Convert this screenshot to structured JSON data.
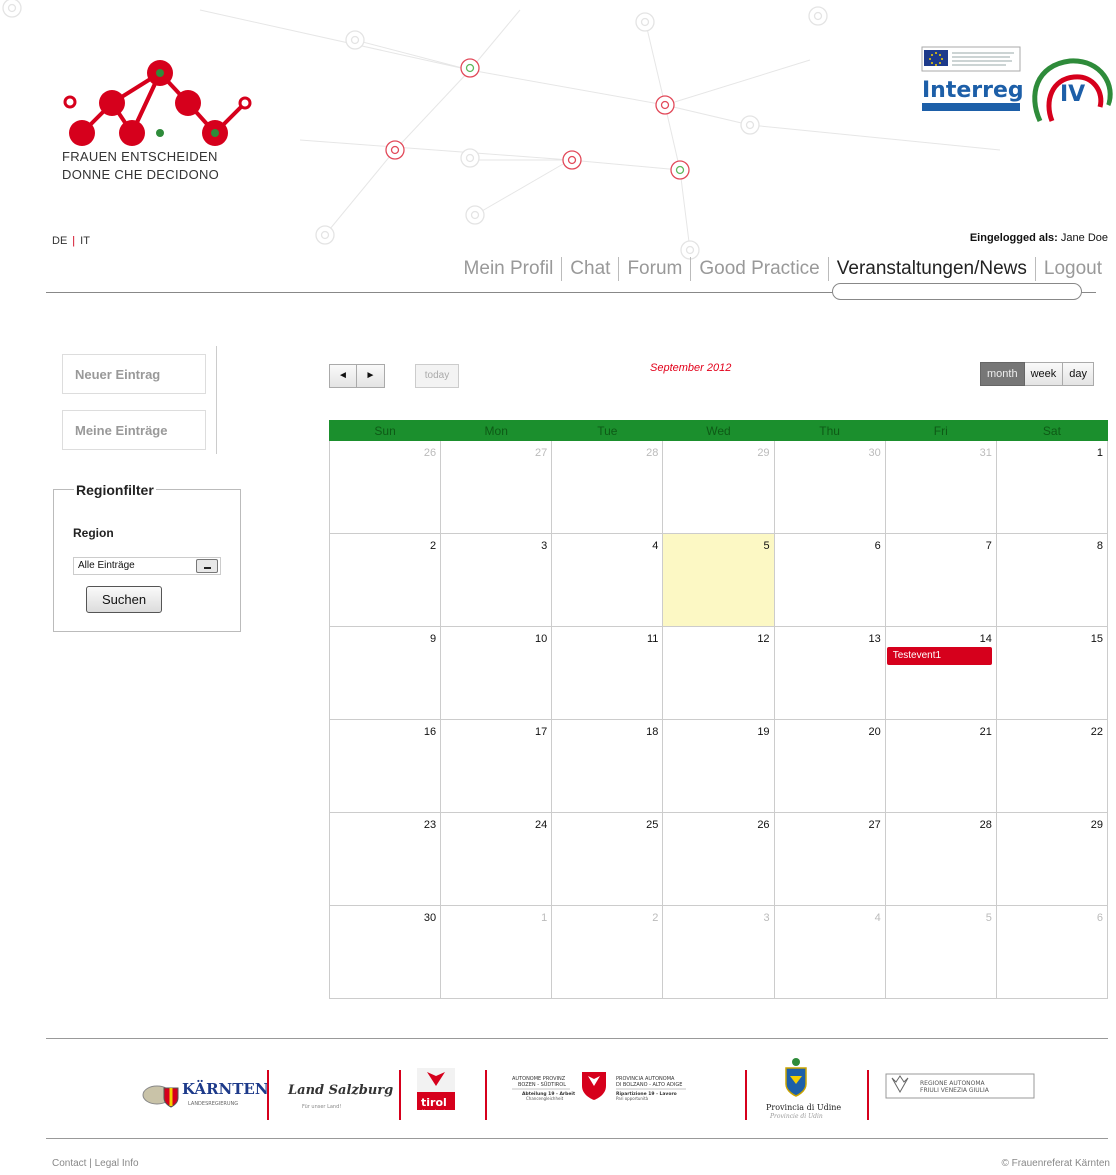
{
  "brand": {
    "line1": "FRAUEN ENTSCHEIDEN",
    "line2": "DONNE CHE DECIDONO"
  },
  "interreg": {
    "text": "Interreg",
    "roman": "IV"
  },
  "languages": [
    "DE",
    "IT"
  ],
  "user": {
    "label": "Eingelogged als:",
    "name": "Jane Doe"
  },
  "nav": [
    "Mein Profil",
    "Chat",
    "Forum",
    "Good Practice",
    "Veranstaltungen/News",
    "Logout"
  ],
  "sidebar": {
    "buttons": [
      "Neuer Eintrag",
      "Meine Einträge"
    ],
    "filter": {
      "legend": "Regionfilter",
      "label": "Region",
      "select": "Alle Einträge",
      "submit": "Suchen"
    }
  },
  "calendar": {
    "prev": "◄",
    "next": "►",
    "today": "today",
    "title": "September 2012",
    "views": [
      "month",
      "week",
      "day"
    ],
    "active_view": "month",
    "weekdays": [
      "Sun",
      "Mon",
      "Tue",
      "Wed",
      "Thu",
      "Fri",
      "Sat"
    ],
    "weeks": [
      [
        {
          "d": "26",
          "o": true
        },
        {
          "d": "27",
          "o": true
        },
        {
          "d": "28",
          "o": true
        },
        {
          "d": "29",
          "o": true
        },
        {
          "d": "30",
          "o": true
        },
        {
          "d": "31",
          "o": true
        },
        {
          "d": "1"
        }
      ],
      [
        {
          "d": "2"
        },
        {
          "d": "3"
        },
        {
          "d": "4"
        },
        {
          "d": "5",
          "today": true
        },
        {
          "d": "6"
        },
        {
          "d": "7"
        },
        {
          "d": "8"
        }
      ],
      [
        {
          "d": "9"
        },
        {
          "d": "10"
        },
        {
          "d": "11"
        },
        {
          "d": "12"
        },
        {
          "d": "13"
        },
        {
          "d": "14",
          "event": "Testevent1"
        },
        {
          "d": "15"
        }
      ],
      [
        {
          "d": "16"
        },
        {
          "d": "17"
        },
        {
          "d": "18"
        },
        {
          "d": "19"
        },
        {
          "d": "20"
        },
        {
          "d": "21"
        },
        {
          "d": "22"
        }
      ],
      [
        {
          "d": "23"
        },
        {
          "d": "24"
        },
        {
          "d": "25"
        },
        {
          "d": "26"
        },
        {
          "d": "27"
        },
        {
          "d": "28"
        },
        {
          "d": "29"
        }
      ],
      [
        {
          "d": "30"
        },
        {
          "d": "1",
          "o": true
        },
        {
          "d": "2",
          "o": true
        },
        {
          "d": "3",
          "o": true
        },
        {
          "d": "4",
          "o": true
        },
        {
          "d": "5",
          "o": true
        },
        {
          "d": "6",
          "o": true
        }
      ]
    ]
  },
  "sponsors": {
    "karnten": {
      "name": "KÄRNTEN",
      "sub": "LANDESREGIERUNG"
    },
    "salzburg": {
      "name": "Land Salzburg",
      "sub": "Für unser Land!"
    },
    "tirol": {
      "name": "tirol",
      "sub": "Unser Land"
    },
    "bozen_de": {
      "l1": "AUTONOME PROVINZ",
      "l2": "BOZEN - SÜDTIROL",
      "l3": "Abteilung 19 - Arbeit",
      "l4": "Chancengleichheit"
    },
    "bozen_it": {
      "l1": "PROVINCIA AUTONOMA",
      "l2": "DI BOLZANO - ALTO ADIGE",
      "l3": "Ripartizione 19 - Lavoro",
      "l4": "Pari opportunità"
    },
    "udine": {
      "l1": "Provincia di Udine",
      "l2": "Provincie di Udin"
    },
    "fvg": {
      "l1": "REGIONE AUTONOMA",
      "l2": "FRIULI VENEZIA GIULIA"
    }
  },
  "footer": {
    "links": [
      "Contact",
      "Legal Info"
    ],
    "copyright": "© Frauenreferat Kärnten"
  },
  "colors": {
    "accent": "#e2001a",
    "header_green": "#1b8f2d",
    "today_bg": "#fcf8c4"
  }
}
